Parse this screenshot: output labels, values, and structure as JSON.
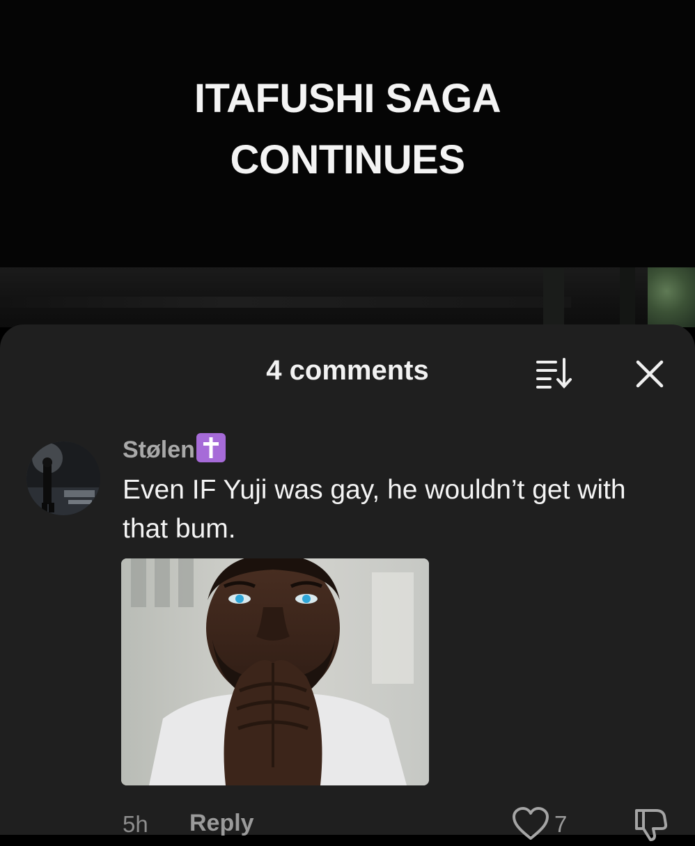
{
  "video": {
    "caption_lines": [
      "ITAFUSHI SAGA",
      "CONTINUES"
    ]
  },
  "sheet": {
    "title": "4 comments",
    "sort_icon": "sort-descending-icon",
    "close_icon": "close-icon"
  },
  "comment": {
    "username": "Stølen",
    "badge_icon": "latin-cross-icon",
    "badge_color": "#a66bd8",
    "text": "Even IF Yuji was gay, he wouldn’t get with that bum.",
    "time": "5h",
    "reply_label": "Reply",
    "like_count": "7",
    "like_icon": "heart-icon",
    "dislike_icon": "thumbs-down-icon"
  }
}
